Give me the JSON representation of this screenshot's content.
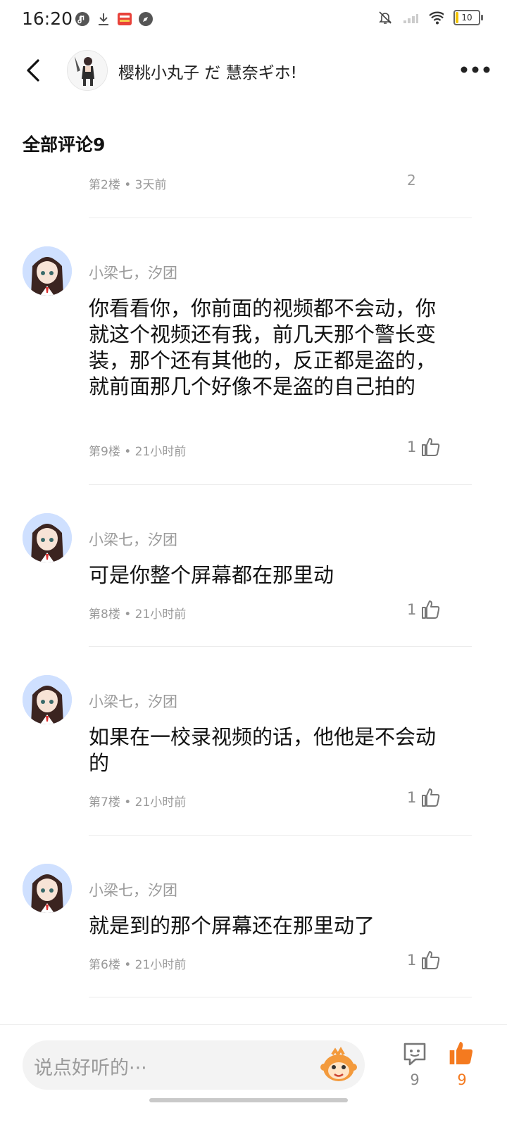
{
  "status_bar": {
    "time": "16:20",
    "battery": "10"
  },
  "header": {
    "name": "樱桃小丸子  だ   慧奈ギホ!"
  },
  "section_title": "全部评论9",
  "partial_comment": {
    "meta": "第2楼 • 3天前",
    "likes": "2"
  },
  "comments": [
    {
      "author": "小梁七，汐团",
      "text": "你看看你，你前面的视频都不会动，你就这个视频还有我，前几天那个警长变装，那个还有其他的，反正都是盗的，就前面那几个好像不是盗的自己拍的",
      "meta": "第9楼 • 21小时前",
      "likes": "1"
    },
    {
      "author": "小梁七，汐团",
      "text": "可是你整个屏幕都在那里动",
      "meta": "第8楼 • 21小时前",
      "likes": "1"
    },
    {
      "author": "小梁七，汐团",
      "text": "如果在一校录视频的话，他他是不会动的",
      "meta": "第7楼 • 21小时前",
      "likes": "1"
    },
    {
      "author": "小梁七，汐团",
      "text": "就是到的那个屏幕还在那里动了",
      "meta": "第6楼 • 21小时前",
      "likes": "1"
    }
  ],
  "bottom_bar": {
    "placeholder": "说点好听的···",
    "comment_count": "9",
    "like_count": "9"
  },
  "colors": {
    "accent": "#f47a1f",
    "secondary_text": "#9a9a9a",
    "avatar_bg": "#cfe0ff"
  }
}
